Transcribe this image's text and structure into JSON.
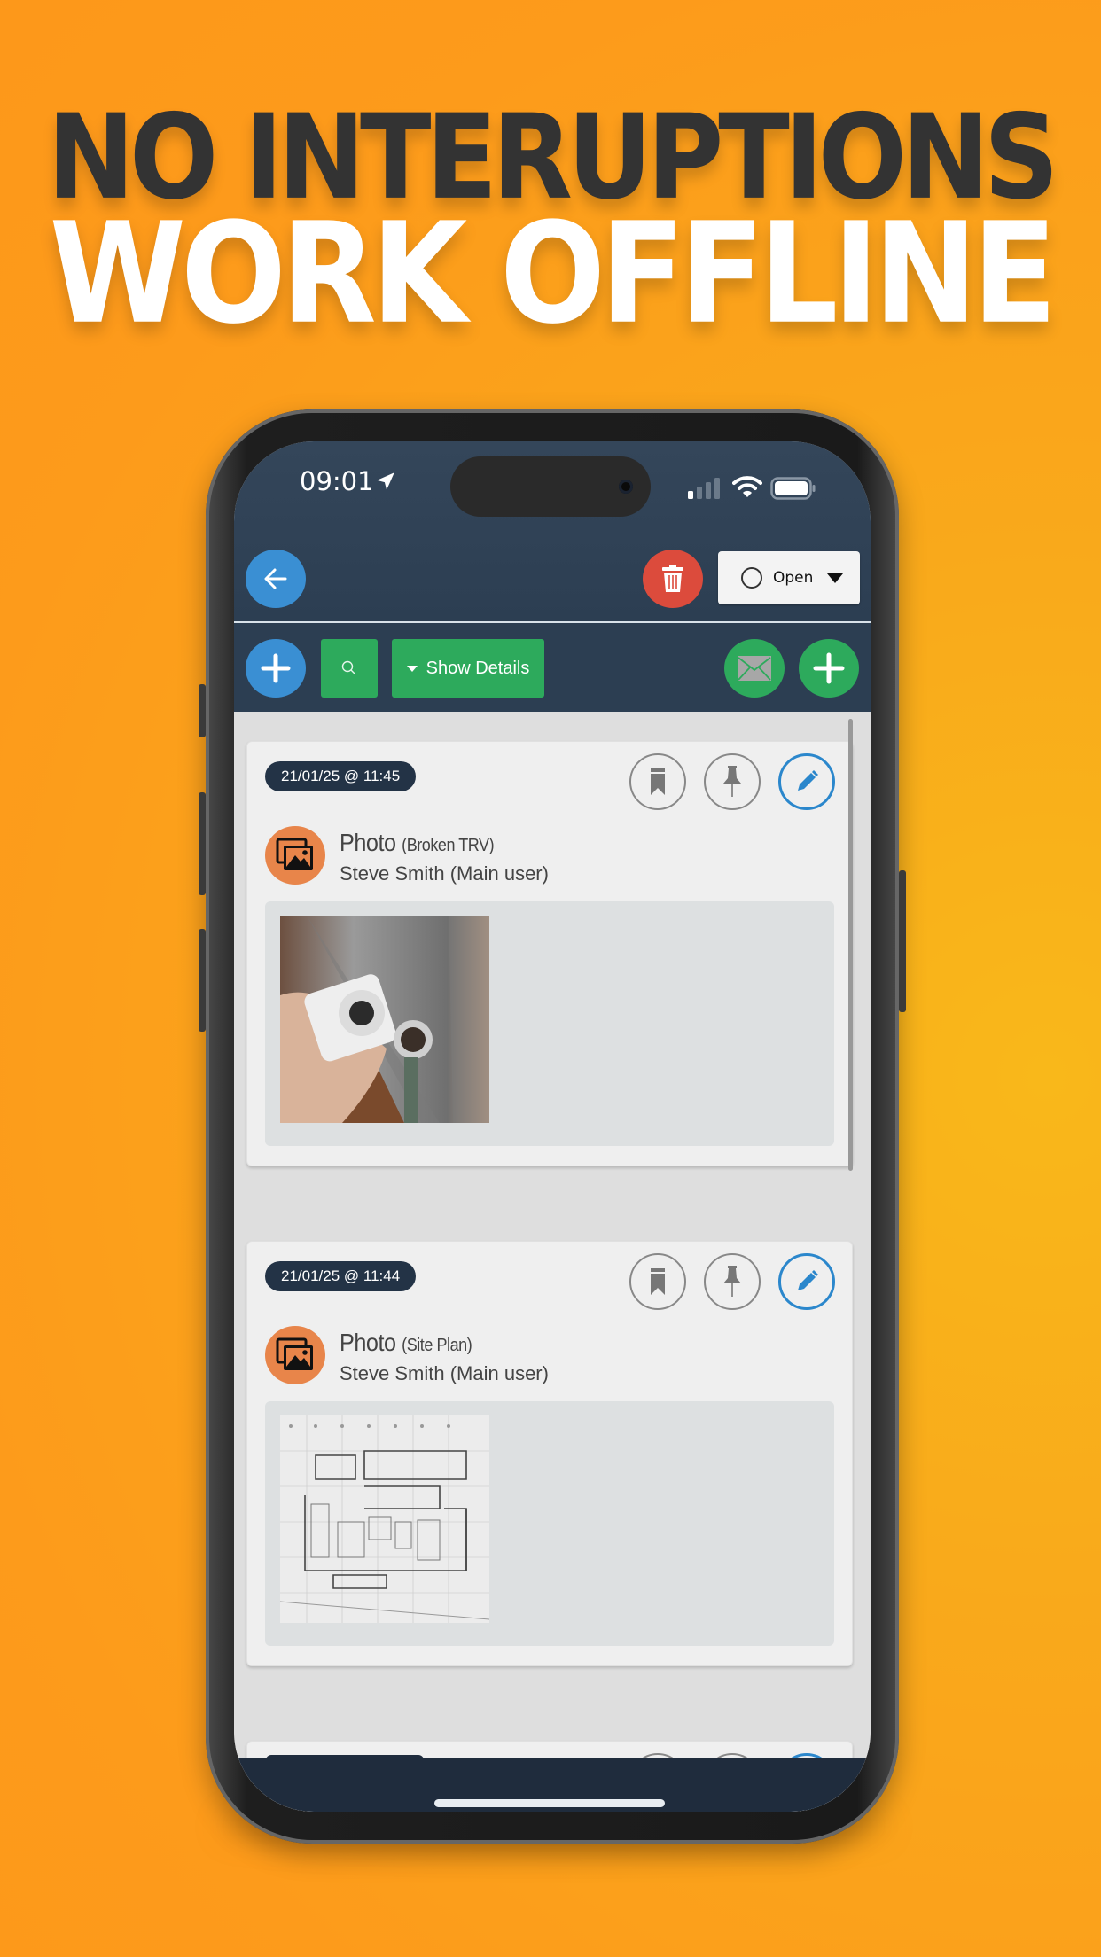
{
  "headline": {
    "line1": "NO INTERUPTIONS",
    "line2": "WORK OFFLINE"
  },
  "colors": {
    "background": "#fd9b1b",
    "headline_dark": "#333333",
    "header_bg": "#2c3e52",
    "blue": "#3a8fd3",
    "red": "#dc4b3c",
    "green": "#2daa5c",
    "avatar_orange": "#e8854a",
    "date_pill": "#233346"
  },
  "status_bar": {
    "time": "09:01",
    "location_icon": "location-arrow-icon",
    "signal_icon": "cellular-signal-icon",
    "wifi_icon": "wifi-icon",
    "battery_icon": "battery-icon"
  },
  "header": {
    "back_icon": "arrow-left-icon",
    "delete_icon": "trash-icon",
    "status_select": {
      "value": "Open",
      "radio_icon": "radio-circle-icon",
      "caret_icon": "caret-down-icon"
    }
  },
  "toolbar": {
    "add_icon": "plus-icon",
    "search_icon": "search-icon",
    "show_details_label": "Show Details",
    "mail_icon": "envelope-icon",
    "add_green_icon": "plus-icon"
  },
  "entries": [
    {
      "date": "21/01/25 @ 11:45",
      "type": "Photo",
      "caption": "(Broken TRV)",
      "author": "Steve Smith (Main user)",
      "image": "Photo of broken thermostatic radiator valve",
      "actions": [
        "bookmark-icon",
        "pin-icon",
        "pencil-icon"
      ]
    },
    {
      "date": "21/01/25 @ 11:44",
      "type": "Photo",
      "caption": "(Site Plan)",
      "author": "Steve Smith (Main user)",
      "image": "Architectural floor plan drawing",
      "actions": [
        "bookmark-icon",
        "pin-icon",
        "pencil-icon"
      ]
    }
  ]
}
